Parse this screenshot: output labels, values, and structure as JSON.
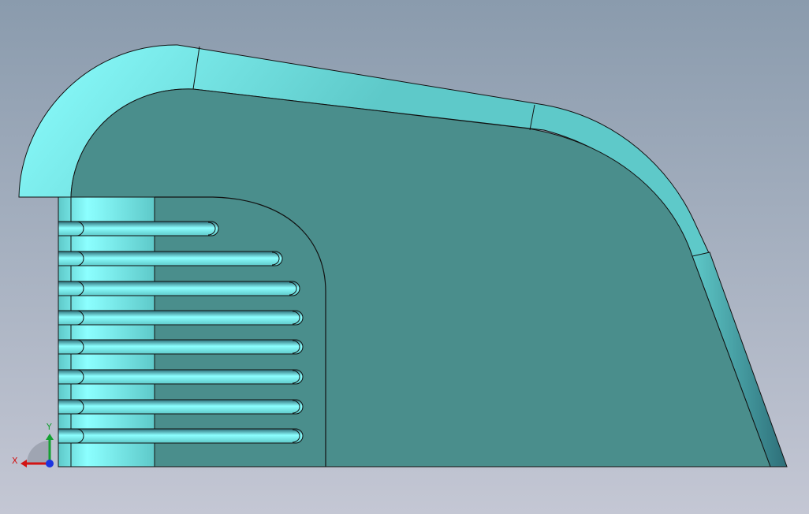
{
  "viewport": {
    "background_top": "#8a9bad",
    "background_bottom": "#c4c7d4"
  },
  "part": {
    "face_color": "#4a8e8c",
    "cylinder_highlight": "#8cffff",
    "cylinder_mid": "#5ec9c9",
    "cylinder_shadow": "#2d6e78",
    "edge_color": "#111111",
    "slot_count": 8
  },
  "triad": {
    "x_label": "X",
    "y_label": "Y",
    "x_color": "#d21414",
    "y_color": "#14a032",
    "z_color": "#1c34e0"
  }
}
